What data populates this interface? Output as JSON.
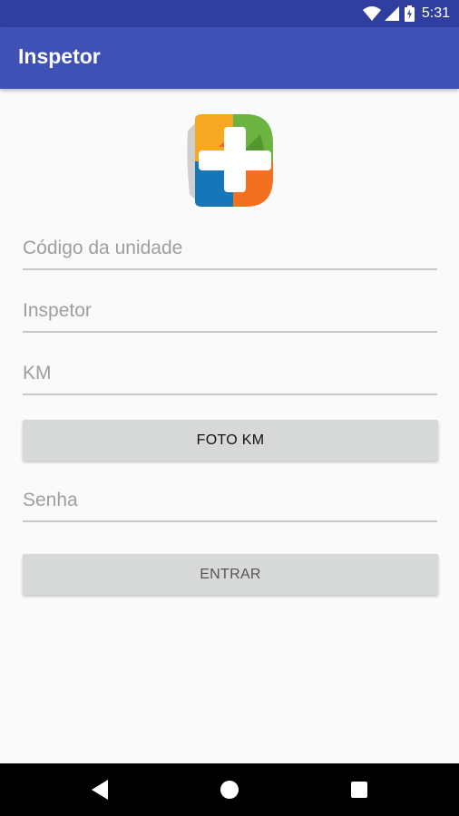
{
  "status_bar": {
    "time": "5:31",
    "icons": [
      "wifi-icon",
      "signal-icon",
      "battery-icon"
    ]
  },
  "app_bar": {
    "title": "Inspetor"
  },
  "logo": {
    "icon": "app-logo-icon"
  },
  "form": {
    "unit_code": {
      "value": "",
      "placeholder": "Código da unidade"
    },
    "inspector": {
      "value": "",
      "placeholder": "Inspetor"
    },
    "km": {
      "value": "",
      "placeholder": "KM"
    },
    "photo_km_button": "FOTO KM",
    "password": {
      "value": "",
      "placeholder": "Senha"
    },
    "login_button": "ENTRAR"
  },
  "nav_bar": {
    "icons": [
      "back-icon",
      "home-icon",
      "recents-icon"
    ]
  },
  "colors": {
    "primary": "#3f51b5",
    "primary_dark": "#303f9f",
    "button_gray": "#d7d8d8",
    "background": "#fafafa"
  }
}
